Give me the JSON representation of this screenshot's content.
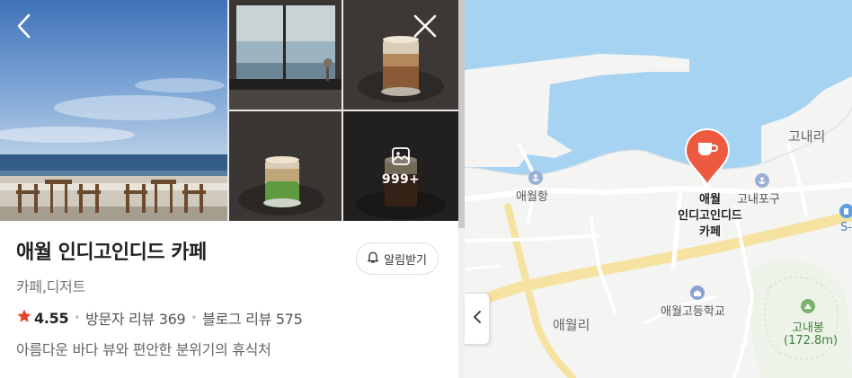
{
  "photos": {
    "more_count": "999+"
  },
  "place": {
    "name": "애월 인디고인디드 카페",
    "category": "카페,디저트",
    "rating": "4.55",
    "visitor_reviews": "방문자 리뷰 369",
    "blog_reviews": "블로그 리뷰 575",
    "description": "아름다운 바다 뷰와 편안한 분위기의 휴식처",
    "alarm_label": "알림받기"
  },
  "map": {
    "pin_label": "애월\n인디고인디드\n카페",
    "labels": {
      "aewol_port": "애월항",
      "gonae_port": "고내포구",
      "gonae_ri": "고내리",
      "aewol_ri": "애월리",
      "aewol_high": "애월고등학교",
      "gonaebong": "고내봉",
      "gonaebong_height": "(172.8m)",
      "s_oil": "S-O"
    },
    "colors": {
      "sea": "#a7d3f2",
      "land": "#f4f4f2",
      "road": "#f6e3a1",
      "pin": "#ee5a3f"
    }
  },
  "icons": {
    "back": "chevron-left-icon",
    "close": "close-icon",
    "gallery": "image-icon",
    "star": "star-icon",
    "bell": "bell-icon",
    "collapse": "chevron-left-icon",
    "cafe": "coffee-cup-icon"
  }
}
